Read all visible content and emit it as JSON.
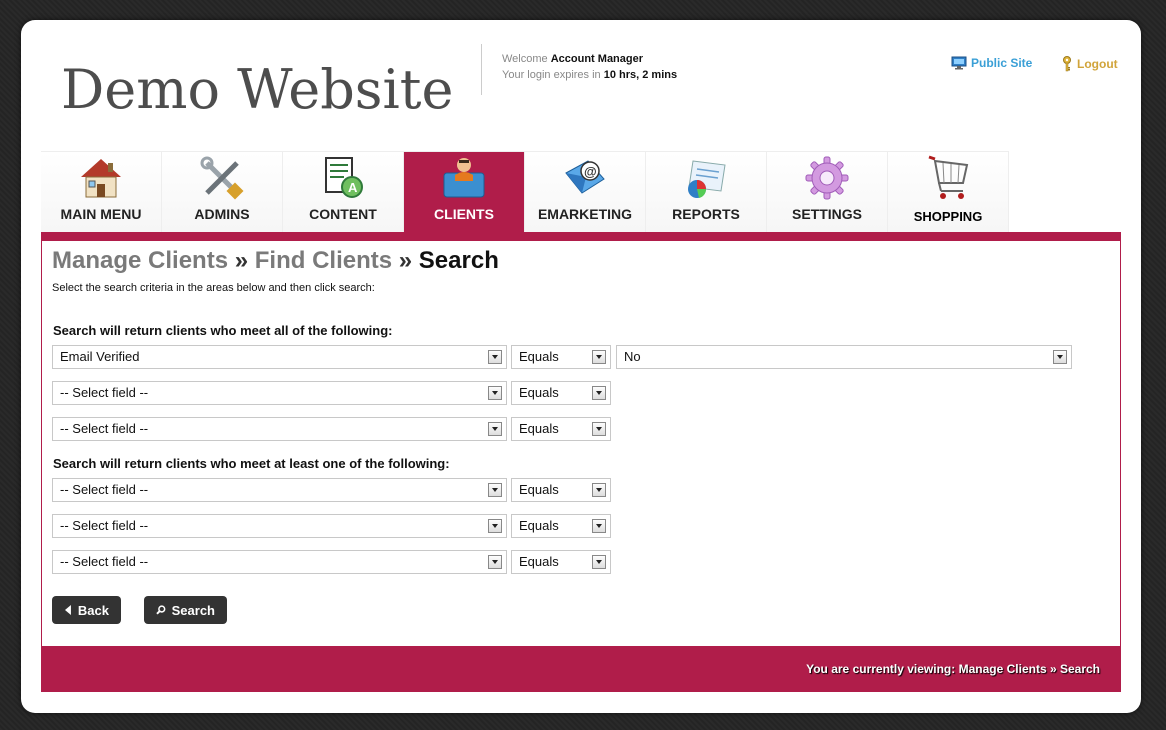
{
  "header": {
    "logo": "Demo Website",
    "welcome_prefix": "Welcome",
    "user_name": "Account Manager",
    "expires_prefix": "Your login expires in",
    "expires_time": "10 hrs, 2 mins",
    "public_site": "Public Site",
    "logout": "Logout"
  },
  "tabs": [
    {
      "label": "MAIN MENU",
      "icon": "house-icon"
    },
    {
      "label": "ADMINS",
      "icon": "tools-icon"
    },
    {
      "label": "CONTENT",
      "icon": "document-icon"
    },
    {
      "label": "CLIENTS",
      "icon": "clients-icon"
    },
    {
      "label": "EMARKETING",
      "icon": "email-icon"
    },
    {
      "label": "REPORTS",
      "icon": "report-icon"
    },
    {
      "label": "SETTINGS",
      "icon": "gear-icon"
    },
    {
      "label": "SHOPPING",
      "icon": "cart-icon"
    }
  ],
  "breadcrumb": {
    "part1": "Manage Clients",
    "sep": "»",
    "part2": "Find Clients",
    "current": "Search"
  },
  "instructions": "Select the search criteria in the areas below and then click search:",
  "group_all": {
    "title": "Search will return clients who meet all of the following:",
    "rows": [
      {
        "field": "Email Verified",
        "op": "Equals",
        "value": "No"
      },
      {
        "field": "-- Select field --",
        "op": "Equals"
      },
      {
        "field": "-- Select field --",
        "op": "Equals"
      }
    ]
  },
  "group_any": {
    "title": "Search will return clients who meet at least one of the following:",
    "rows": [
      {
        "field": "-- Select field --",
        "op": "Equals"
      },
      {
        "field": "-- Select field --",
        "op": "Equals"
      },
      {
        "field": "-- Select field --",
        "op": "Equals"
      }
    ]
  },
  "buttons": {
    "back": "Back",
    "search": "Search"
  },
  "footer": {
    "prefix": "You are currently viewing:",
    "path": "Manage Clients » Search"
  },
  "colors": {
    "accent": "#b01d4a",
    "link_blue": "#3a9fd6",
    "link_gold": "#d1a43a"
  }
}
